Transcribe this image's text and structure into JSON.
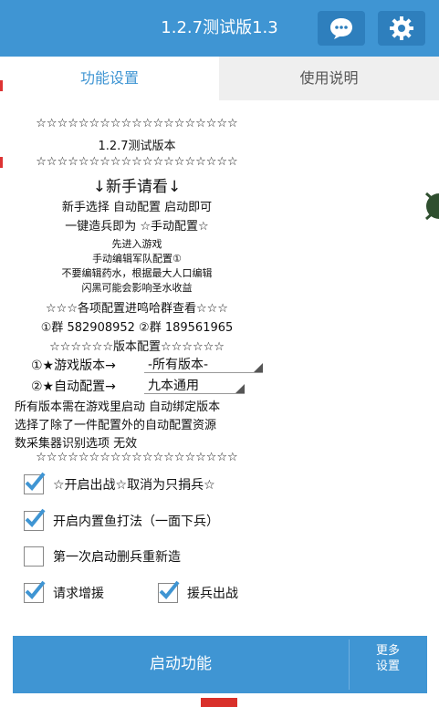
{
  "header": {
    "title": "1.2.7测试版1.3",
    "chat_icon": "chat-bubble-icon",
    "settings_icon": "gear-icon"
  },
  "tabs": [
    {
      "label": "功能设置"
    },
    {
      "label": "使用说明"
    }
  ],
  "content": {
    "stars_line": "☆☆☆☆☆☆☆☆☆☆☆☆☆☆☆☆☆☆☆",
    "version_text": "1.2.7测试版本",
    "newbie_title": "↓新手请看↓",
    "newbie_line1": "新手选择 自动配置 启动即可",
    "newbie_line2": "一键造兵即为 ☆手动配置☆",
    "newbie_line3": "先进入游戏",
    "newbie_line4": "手动编辑军队配置①",
    "newbie_line5": "不要编辑药水，根据最大人口编辑",
    "newbie_line6": "闪黑可能会影响圣水收益",
    "group_title": "☆☆☆各项配置进鸣哈群查看☆☆☆",
    "group_line": "①群 582908952   ②群 189561965",
    "version_config_title": "☆☆☆☆☆☆版本配置☆☆☆☆☆☆",
    "game_version_label": "①★游戏版本→",
    "game_version_value": "-所有版本-",
    "auto_config_label": "②★自动配置→",
    "auto_config_value": "九本通用",
    "note_line1": "所有版本需在游戏里启动 自动绑定版本",
    "note_line2": "选择了除了一件配置外的自动配置资源",
    "note_line3": "数采集器识别选项 无效"
  },
  "options": {
    "opt1": {
      "label": "☆开启出战☆取消为只捐兵☆",
      "checked": true
    },
    "opt2": {
      "label": "开启内置鱼打法（一面下兵）",
      "checked": true
    },
    "opt3": {
      "label": "第一次启动删兵重新造",
      "checked": false
    },
    "opt4": {
      "label": "请求增援",
      "checked": true
    },
    "opt5": {
      "label": "援兵出战",
      "checked": true
    }
  },
  "footer": {
    "start_label": "启动功能",
    "more_label": "更多\n设置"
  },
  "colors": {
    "primary": "#3f95d3",
    "check": "#3f95d3"
  }
}
